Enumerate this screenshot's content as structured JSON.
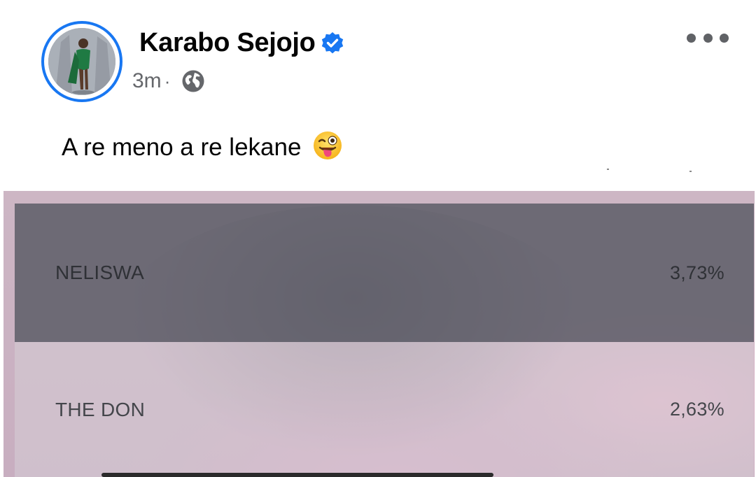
{
  "post": {
    "author_name": "Karabo Sejojo",
    "verified": true,
    "timestamp": "3m",
    "separator": "·",
    "audience": "globe-icon",
    "text": "A re meno a re lekane",
    "emoji": "winking-face-with-tongue"
  },
  "poll_image": {
    "options": [
      {
        "name": "NELISWA",
        "percent": "3,73%"
      },
      {
        "name": "THE DON",
        "percent": "2,63%"
      }
    ]
  },
  "colors": {
    "accent": "#1877f2",
    "text_primary": "#050505",
    "text_secondary": "#65676b"
  }
}
